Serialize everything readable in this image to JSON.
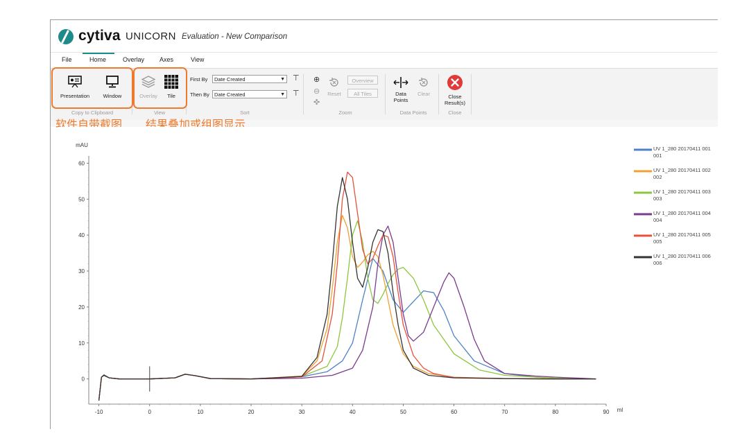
{
  "app": {
    "brand": "cytiva",
    "product": "UNICORN",
    "window_title": "Evaluation - New Comparison"
  },
  "menu": {
    "items": [
      "File",
      "Home",
      "Overlay",
      "Axes",
      "View"
    ],
    "active": "Home"
  },
  "ribbon": {
    "copy_group": {
      "label": "Copy to Clipboard",
      "presentation": "Presentation",
      "window": "Window"
    },
    "view_group": {
      "label": "View",
      "overlay": "Overlay",
      "tile": "Tile"
    },
    "sort_group": {
      "label": "Sort",
      "first_by_label": "First By",
      "first_by_value": "Date Created",
      "then_by_label": "Then By",
      "then_by_value": "Date Created"
    },
    "zoom_group": {
      "label": "Zoom",
      "reset": "Reset",
      "overview": "Overview",
      "all_tiles": "All Tiles"
    },
    "datapoints_group": {
      "label": "Data Points",
      "data_points_line1": "Data",
      "data_points_line2": "Points",
      "clear": "Clear"
    },
    "close_group": {
      "label": "Close",
      "close_line1": "Close",
      "close_line2": "Result(s)"
    }
  },
  "annotations": {
    "left": "软件自带截图",
    "right": "结果叠加或组图显示",
    "color": "#f07a2b"
  },
  "chart_data": {
    "type": "line",
    "xlabel": "ml",
    "ylabel": "mAU",
    "xlim": [
      -12,
      90
    ],
    "ylim": [
      -7,
      62
    ],
    "xticks": [
      "-10",
      "0",
      "10",
      "20",
      "30",
      "40",
      "50",
      "60",
      "70",
      "80",
      "90"
    ],
    "yticks": [
      "0",
      "10",
      "20",
      "30",
      "40",
      "50",
      "60"
    ],
    "legend_position": "right",
    "series": [
      {
        "name": "UV 1_280 20170411 001",
        "color": "#4f81c7",
        "x": [
          -10,
          -9.5,
          -9,
          -8,
          -6,
          0,
          5,
          7,
          9,
          12,
          20,
          30,
          35,
          38,
          40,
          42,
          44,
          46,
          48,
          50,
          52,
          54,
          56,
          58,
          60,
          64,
          70,
          76,
          80,
          85,
          88
        ],
        "y": [
          -6,
          0.5,
          1.2,
          0.3,
          0,
          0,
          0.3,
          1.3,
          0.9,
          0.1,
          0,
          0.6,
          2,
          5,
          10,
          22,
          33.5,
          30,
          22,
          18.5,
          21.5,
          24.5,
          24,
          19,
          12,
          5,
          1.5,
          0.5,
          0.2,
          0,
          0
        ]
      },
      {
        "name": "UV 1_280 20170411 002",
        "color": "#f0a030",
        "x": [
          -10,
          -9.5,
          -9,
          -8,
          -6,
          0,
          5,
          7,
          9,
          12,
          20,
          30,
          33,
          35,
          36,
          37,
          38,
          39,
          40,
          41,
          42,
          43,
          44,
          45,
          46,
          47,
          48,
          50,
          52,
          55,
          60,
          70,
          80,
          88
        ],
        "y": [
          -6,
          0.5,
          1,
          0.3,
          0,
          0,
          0.3,
          1.3,
          0.9,
          0.1,
          0,
          0.8,
          5,
          14,
          25,
          38,
          45.5,
          42,
          34,
          31,
          32.5,
          34.5,
          35.5,
          34,
          29,
          22,
          15,
          7,
          3.5,
          1.5,
          0.5,
          0.1,
          0,
          0
        ]
      },
      {
        "name": "UV 1_280 20170411 003",
        "color": "#8dc63f",
        "x": [
          -10,
          -9.5,
          -9,
          -8,
          -6,
          0,
          5,
          7,
          9,
          12,
          20,
          30,
          35,
          37,
          38,
          39,
          40,
          41,
          42,
          43,
          44,
          45,
          46,
          47,
          48,
          49,
          50,
          52,
          54,
          56,
          60,
          65,
          70,
          80,
          88
        ],
        "y": [
          -6,
          0.5,
          1,
          0.3,
          0,
          0,
          0.3,
          1.3,
          0.9,
          0.1,
          0,
          0.7,
          3.5,
          9,
          17,
          28,
          40,
          44,
          38,
          28,
          22,
          21,
          23.5,
          26.5,
          29,
          30.5,
          31,
          28,
          22,
          15,
          7,
          2.5,
          1,
          0.2,
          0
        ]
      },
      {
        "name": "UV 1_280 20170411 004",
        "color": "#7b3a8c",
        "x": [
          -10,
          -9.5,
          -9,
          -8,
          -6,
          0,
          5,
          7,
          9,
          12,
          20,
          30,
          36,
          40,
          42,
          44,
          45,
          46,
          47,
          48,
          49,
          50,
          51,
          52,
          54,
          56,
          58,
          59,
          60,
          62,
          64,
          66,
          70,
          76,
          80,
          85,
          88
        ],
        "y": [
          -6,
          0.5,
          1,
          0.3,
          0,
          0,
          0.3,
          1.3,
          0.9,
          0.1,
          0,
          0.2,
          1,
          3,
          8,
          20,
          32,
          40,
          42.5,
          38,
          28,
          18,
          12,
          10.5,
          13,
          20,
          27,
          29.5,
          28,
          20,
          11,
          5,
          1.5,
          0.8,
          0.5,
          0.2,
          0
        ]
      },
      {
        "name": "UV 1_280 20170411 005",
        "color": "#e8503a",
        "x": [
          -10,
          -9.5,
          -9,
          -8,
          -6,
          0,
          5,
          7,
          9,
          12,
          20,
          30,
          34,
          36,
          37,
          38,
          39,
          40,
          41,
          42,
          43,
          44,
          45,
          46,
          47,
          48,
          49,
          50,
          52,
          54,
          56,
          60,
          70,
          80,
          88
        ],
        "y": [
          -6,
          0.5,
          1,
          0.3,
          0,
          0,
          0.3,
          1.3,
          0.9,
          0.1,
          0,
          0.6,
          5,
          18,
          32,
          50,
          57.5,
          56,
          46,
          36,
          32,
          33.5,
          37,
          40,
          39.5,
          34,
          24,
          15,
          6.5,
          3,
          1.5,
          0.4,
          0.1,
          0,
          0
        ]
      },
      {
        "name": "UV 1_280 20170411 006",
        "color": "#333333",
        "x": [
          -10,
          -9.5,
          -9,
          -8,
          -6,
          0,
          5,
          7,
          9,
          12,
          20,
          30,
          33,
          35,
          36,
          37,
          38,
          39,
          40,
          41,
          42,
          43,
          44,
          45,
          46,
          47,
          48,
          49,
          50,
          52,
          55,
          60,
          70,
          80,
          88
        ],
        "y": [
          -6,
          0.5,
          1,
          0.3,
          0,
          0,
          0.3,
          1.3,
          0.9,
          0.1,
          0,
          0.7,
          6,
          18,
          32,
          48,
          56,
          50,
          38,
          28,
          25.5,
          31,
          38,
          41.5,
          41,
          35,
          24,
          15,
          8,
          3,
          1,
          0.3,
          0.1,
          0,
          0
        ]
      }
    ]
  }
}
